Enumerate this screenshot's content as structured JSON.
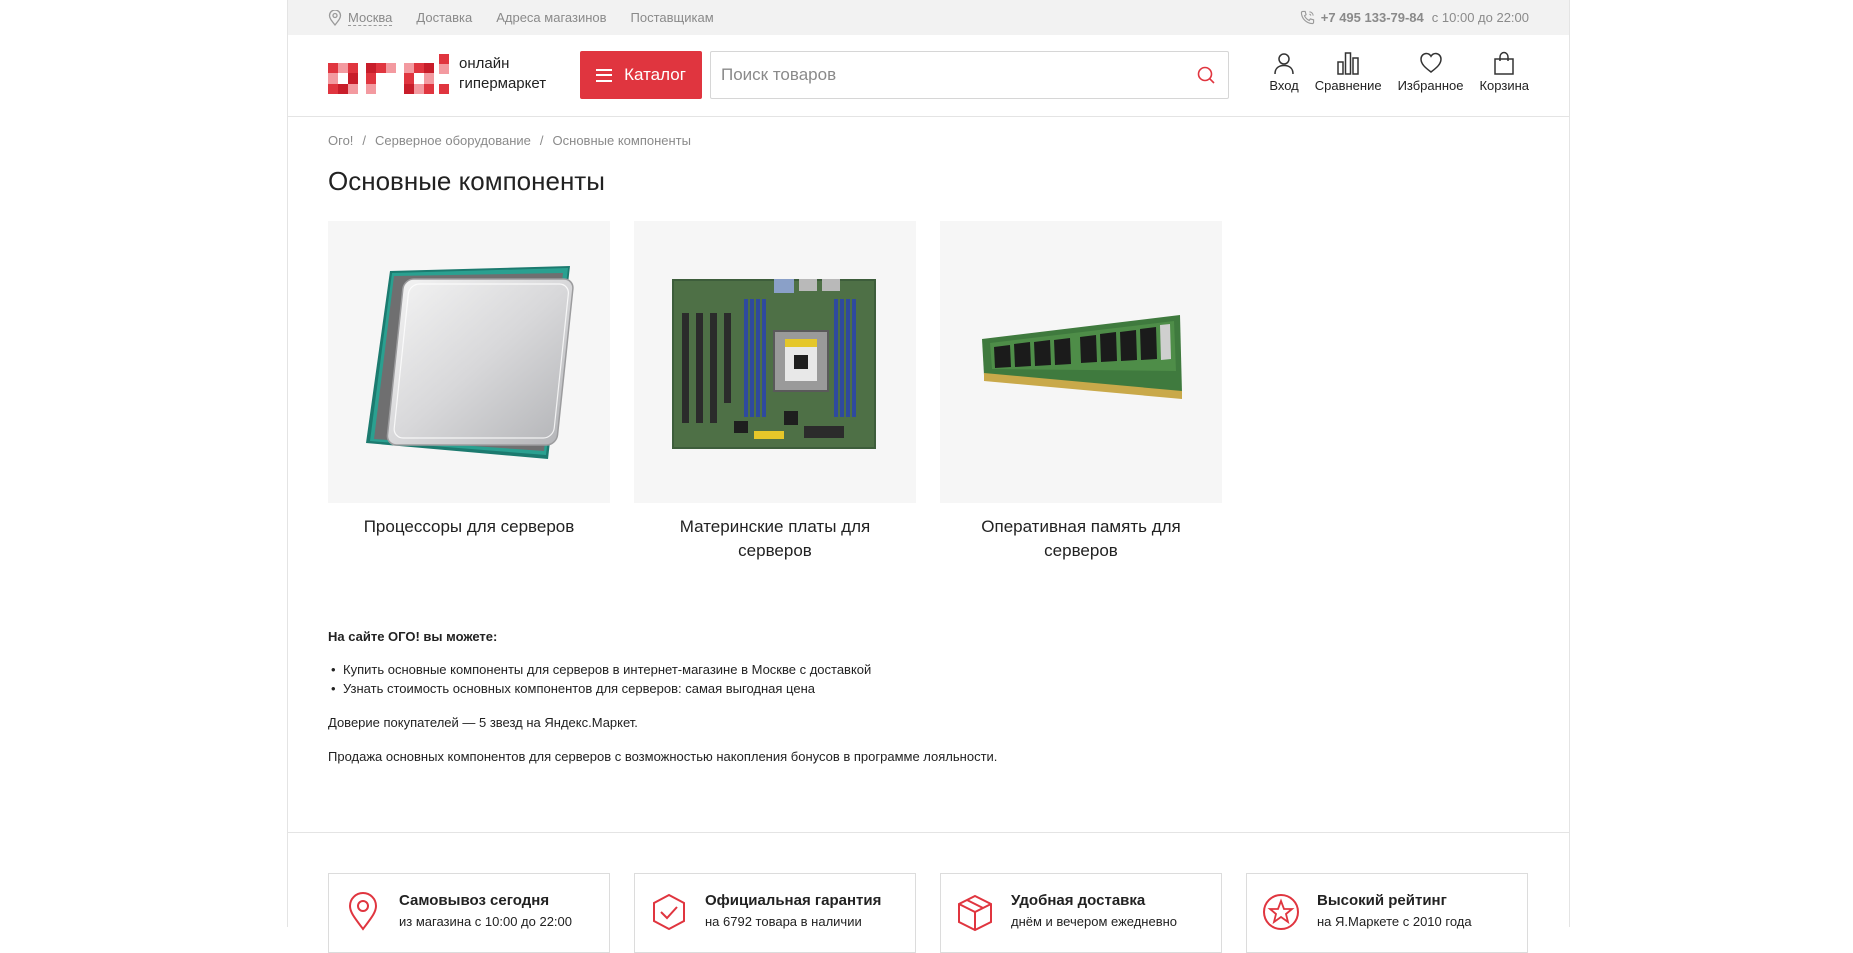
{
  "topbar": {
    "city": "Москва",
    "links": [
      "Доставка",
      "Адреса магазинов",
      "Поставщикам"
    ],
    "phone": "+7 495 133-79-84",
    "hours": "с 10:00 до 22:00",
    "icons": [
      "location-pin-icon",
      "phone-icon"
    ]
  },
  "header": {
    "logo_line1": "онлайн",
    "logo_line2": "гипермаркет",
    "catalog_label": "Каталог",
    "search_placeholder": "Поиск товаров",
    "nav": {
      "login": "Вход",
      "compare": "Сравнение",
      "favorites": "Избранное",
      "cart": "Корзина"
    }
  },
  "breadcrumbs": [
    "Ого!",
    "Серверное оборудование",
    "Основные компоненты"
  ],
  "page_title": "Основные компоненты",
  "categories": [
    {
      "name": "Процессоры для серверов",
      "image": "cpu-image"
    },
    {
      "name": "Материнские платы для серверов",
      "image": "motherboard-image"
    },
    {
      "name": "Оперативная память для серверов",
      "image": "ram-image"
    }
  ],
  "seo": {
    "heading": "На сайте ОГО! вы можете:",
    "bullets": [
      "Купить основные компоненты для серверов в интернет-магазине в Москве с доставкой",
      "Узнать стоимость основных компонентов для серверов: самая выгодная цена"
    ],
    "p1": "Доверие покупателей — 5 звезд на Яндекс.Маркет.",
    "p2": "Продажа основных компонентов для серверов с возможностью накопления бонусов в программе лояльности."
  },
  "features": [
    {
      "title": "Самовывоз сегодня",
      "subtitle": "из магазина с 10:00 до 22:00",
      "icon": "location-pin-icon"
    },
    {
      "title": "Официальная гарантия",
      "subtitle": "на 6792 товара в наличии",
      "icon": "shield-check-icon"
    },
    {
      "title": "Удобная доставка",
      "subtitle": "днём и вечером ежедневно",
      "icon": "box-icon"
    },
    {
      "title": "Высокий рейтинг",
      "subtitle": "на Я.Маркете с 2010 года",
      "icon": "star-badge-icon"
    }
  ],
  "colors": {
    "accent": "#e0353f",
    "topbar_bg": "#f2f2f2",
    "muted_text": "#8a8a8a"
  }
}
